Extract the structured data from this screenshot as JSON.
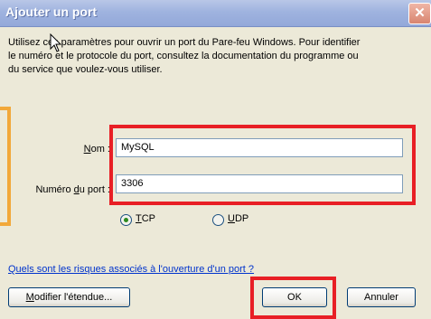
{
  "dialog": {
    "title": "Ajouter un port",
    "close_glyph": "✕",
    "description_lines": [
      "Utilisez ces paramètres pour ouvrir un port du Pare-feu Windows. Pour identifier",
      "le numéro et le protocole du port, consultez la documentation du programme ou",
      "du service que voulez-vous utiliser."
    ]
  },
  "form": {
    "name_label_before": "",
    "name_label_access": "N",
    "name_label_after": "om :",
    "name_value": "MySQL",
    "port_label_before": "Numéro ",
    "port_label_access": "d",
    "port_label_after": "u port :",
    "port_value": "3306"
  },
  "protocol": {
    "tcp_access": "T",
    "tcp_rest": "CP",
    "udp_access": "U",
    "udp_rest": "DP",
    "selected": "TCP"
  },
  "link_text": "Quels sont les risques associés à l'ouverture d'un port ?",
  "buttons": {
    "modify_access": "M",
    "modify_rest": "odifier l'étendue...",
    "ok": "OK",
    "cancel": "Annuler"
  },
  "colors": {
    "highlight_red": "#e81f25",
    "highlight_orange": "#f2a83a",
    "titlebar": "#9fb3df",
    "link": "#0033cc"
  },
  "icons": [
    "close-icon",
    "cursor-icon",
    "radio-icon"
  ]
}
